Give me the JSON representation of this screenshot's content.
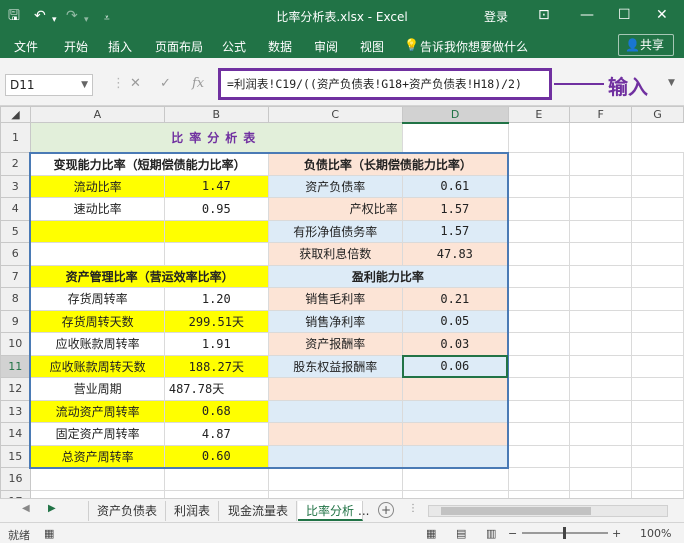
{
  "window": {
    "title": "比率分析表.xlsx - Excel",
    "login": "登录",
    "controls": [
      "⊡",
      "—",
      "☐",
      "✕"
    ]
  },
  "quick_access": {
    "save_icon": "save-icon",
    "undo_icon": "undo-icon",
    "redo_icon": "redo-icon",
    "customize_icon": "customize-icon"
  },
  "ribbon": {
    "tabs": [
      "文件",
      "开始",
      "插入",
      "页面布局",
      "公式",
      "数据",
      "审阅",
      "视图"
    ],
    "tell_me": "告诉我你想要做什么",
    "share": "共享"
  },
  "formula_bar": {
    "name_box": "D11",
    "cancel": "✕",
    "enter": "✓",
    "fx": "fx",
    "formula": "=利润表!C19/((资产负债表!G18+资产负债表!H18)/2)",
    "annotation": "输入"
  },
  "columns": [
    "A",
    "B",
    "C",
    "D",
    "E",
    "F",
    "G"
  ],
  "rows": [
    "1",
    "2",
    "3",
    "4",
    "5",
    "6",
    "7",
    "8",
    "9",
    "10",
    "11",
    "12",
    "13",
    "14",
    "15",
    "16",
    "17"
  ],
  "sheet": {
    "title": "比率分析表",
    "liquidity_header": "变现能力比率（短期偿债能力比率）",
    "debt_header": "负债比率（长期偿债能力比率）",
    "asset_mgmt_header": "资产管理比率（营运效率比率）",
    "profit_header": "盈利能力比率",
    "left": [
      {
        "label": "流动比率",
        "value": "1.47"
      },
      {
        "label": "速动比率",
        "value": "0.95"
      },
      {
        "label": "",
        "value": ""
      },
      {
        "label": "",
        "value": ""
      },
      {
        "label": "",
        "value": ""
      },
      {
        "label": "存货周转率",
        "value": "1.20"
      },
      {
        "label": "存货周转天数",
        "value": "299.51天"
      },
      {
        "label": "应收账款周转率",
        "value": "1.91"
      },
      {
        "label": "应收账款周转天数",
        "value": "188.27天"
      },
      {
        "label": "营业周期",
        "value": "487.78天"
      },
      {
        "label": "流动资产周转率",
        "value": "0.68"
      },
      {
        "label": "固定资产周转率",
        "value": "4.87"
      },
      {
        "label": "总资产周转率",
        "value": "0.60"
      }
    ],
    "right": [
      {
        "label": "资产负债率",
        "value": "0.61"
      },
      {
        "label": "产权比率",
        "value": "1.57"
      },
      {
        "label": "有形净值债务率",
        "value": "1.57"
      },
      {
        "label": "获取利息倍数",
        "value": "47.83"
      },
      {
        "label": "",
        "value": ""
      },
      {
        "label": "销售毛利率",
        "value": "0.21"
      },
      {
        "label": "销售净利率",
        "value": "0.05"
      },
      {
        "label": "资产报酬率",
        "value": "0.03"
      },
      {
        "label": "股东权益报酬率",
        "value": "0.06"
      }
    ]
  },
  "sheet_tabs": [
    "资产负债表",
    "利润表",
    "现金流量表",
    "比率分析"
  ],
  "active_tab": "比率分析",
  "tab_more": "...",
  "status": {
    "ready": "就绪",
    "zoom": "100%"
  }
}
